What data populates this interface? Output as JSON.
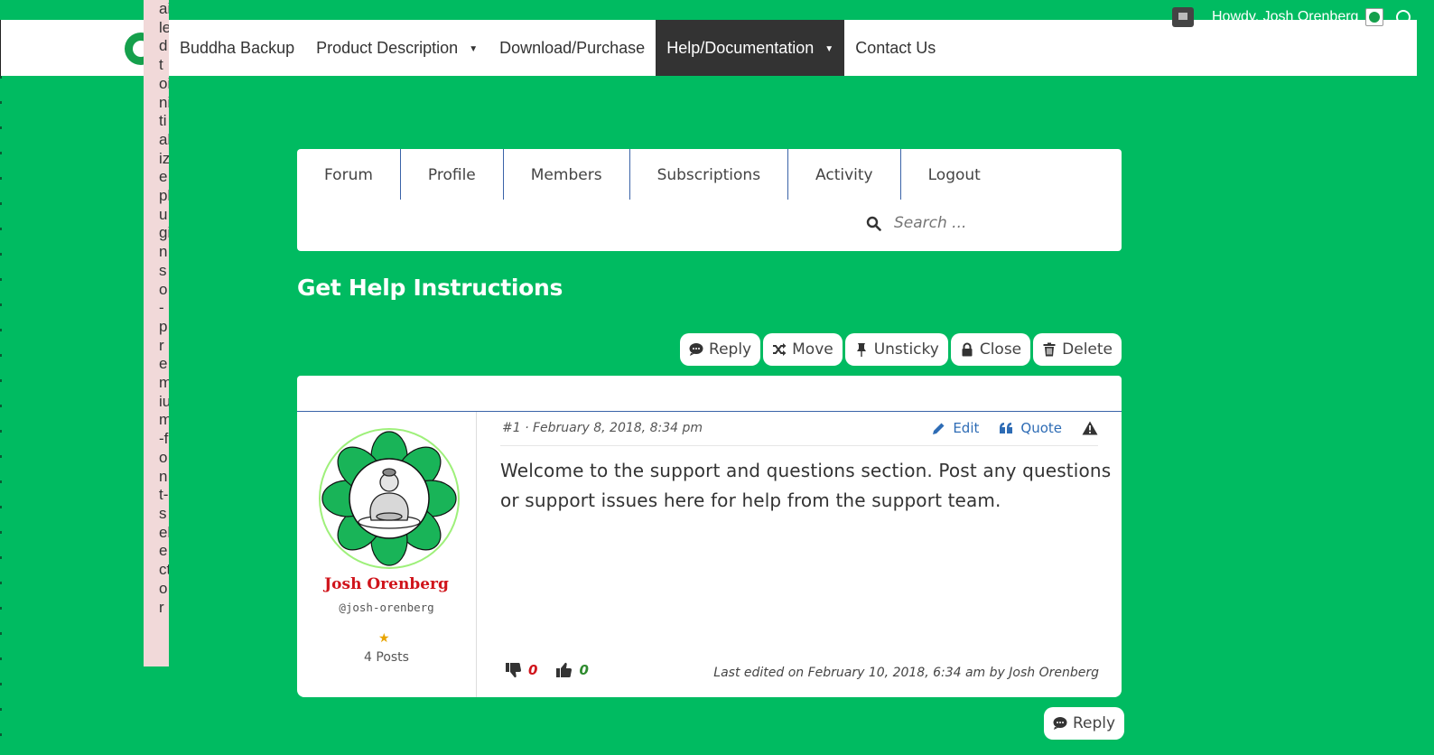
{
  "admin_bar": {
    "greeting": "Howdy, Josh Orenberg"
  },
  "site": {
    "nav": [
      {
        "label": "Buddha Backup",
        "dropdown": false,
        "active": false
      },
      {
        "label": "Product Description",
        "dropdown": true,
        "active": false
      },
      {
        "label": "Download/Purchase",
        "dropdown": false,
        "active": false
      },
      {
        "label": "Help/Documentation",
        "dropdown": true,
        "active": true
      },
      {
        "label": "Contact Us",
        "dropdown": false,
        "active": false
      }
    ],
    "caret": "▼"
  },
  "side_text": "ailedtoinitializeplugin:so-premium-font-selector",
  "forum_nav": {
    "items": [
      "Forum",
      "Profile",
      "Members",
      "Subscriptions",
      "Activity",
      "Logout"
    ],
    "search_placeholder": "Search ..."
  },
  "topic": {
    "title": "Get Help Instructions",
    "actions": [
      "Reply",
      "Move",
      "Unsticky",
      "Close",
      "Delete"
    ]
  },
  "post": {
    "meta": "#1 · February 8, 2018, 8:34 pm",
    "edit_label": "Edit",
    "quote_label": "Quote",
    "body": "Welcome to the support and questions section.  Post any questions or support issues here for help from the support team.",
    "author": {
      "name": "Josh Orenberg",
      "handle": "@josh-orenberg",
      "rank_star": "★",
      "posts": "4 Posts"
    },
    "dislikes": "0",
    "likes": "0",
    "last_edited": "Last edited on February 10, 2018, 6:34 am by Josh Orenberg"
  },
  "bottom_reply_label": "Reply",
  "colors": {
    "page_bg": "#00bb61",
    "nav_active_bg": "#333333",
    "author_name": "#d0141b",
    "link": "#2e6cb5"
  }
}
